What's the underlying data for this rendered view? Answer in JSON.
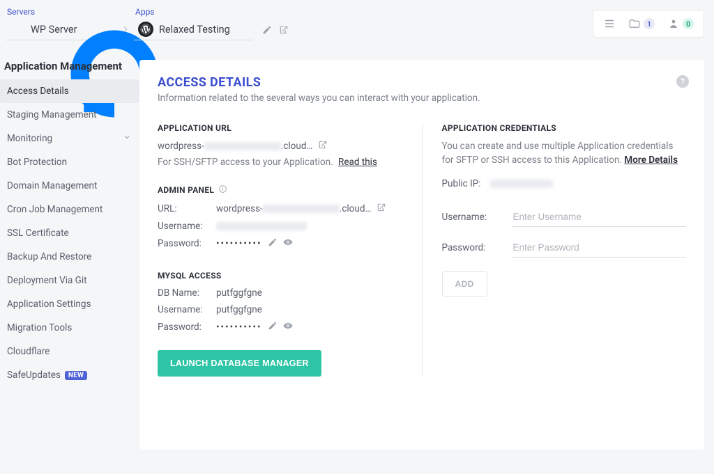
{
  "top": {
    "servers_label": "Servers",
    "server_name": "WP Server",
    "apps_label": "Apps",
    "app_name": "Relaxed Testing",
    "collapsed_badge": "1",
    "avatar_badge": "0"
  },
  "sidebar": {
    "title": "Application Management",
    "items": [
      {
        "label": "Access Details",
        "active": true
      },
      {
        "label": "Staging Management"
      },
      {
        "label": "Monitoring",
        "expandable": true
      },
      {
        "label": "Bot Protection"
      },
      {
        "label": "Domain Management"
      },
      {
        "label": "Cron Job Management"
      },
      {
        "label": "SSL Certificate"
      },
      {
        "label": "Backup And Restore"
      },
      {
        "label": "Deployment Via Git"
      },
      {
        "label": "Application Settings"
      },
      {
        "label": "Migration Tools"
      },
      {
        "label": "Cloudflare"
      },
      {
        "label": "SafeUpdates",
        "badge": "NEW"
      }
    ]
  },
  "card": {
    "title": "ACCESS DETAILS",
    "subtitle": "Information related to the several ways you can interact with your application.",
    "app_url": {
      "heading": "APPLICATION URL",
      "url_prefix": "wordpress-",
      "url_suffix": ".cloud…",
      "hint_prefix": "For SSH/SFTP access to your Application.",
      "hint_link": "Read this"
    },
    "admin_panel": {
      "heading": "ADMIN PANEL",
      "url_label": "URL:",
      "url_prefix": "wordpress-",
      "url_suffix": ".cloud…",
      "username_label": "Username:",
      "password_label": "Password:",
      "password_masked": "••••••••••"
    },
    "mysql": {
      "heading": "MYSQL ACCESS",
      "dbname_label": "DB Name:",
      "dbname_value": "putfggfgne",
      "username_label": "Username:",
      "username_value": "putfggfgne",
      "password_label": "Password:",
      "password_masked": "••••••••••",
      "launch_btn": "LAUNCH DATABASE MANAGER"
    },
    "creds": {
      "heading": "APPLICATION CREDENTIALS",
      "desc": "You can create and use multiple Application credentials for SFTP or SSH access to this Application.",
      "more": "More Details",
      "public_ip_label": "Public IP:",
      "username_label": "Username:",
      "username_placeholder": "Enter Username",
      "password_label": "Password:",
      "password_placeholder": "Enter Password",
      "add_btn": "ADD"
    }
  }
}
